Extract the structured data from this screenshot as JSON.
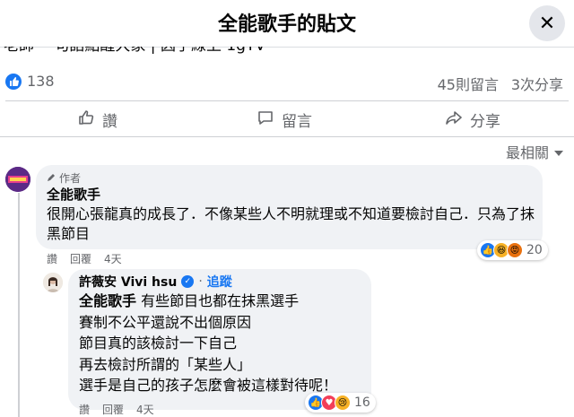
{
  "header": {
    "title": "全能歌手的貼文",
    "close_icon": "close-icon"
  },
  "post": {
    "cut_off_text": "老師 一句話點醒大家 | 因手線上 1gTV"
  },
  "stats": {
    "reaction_count": "138",
    "comment_count": "45則留言",
    "share_count": "3次分享"
  },
  "actions": {
    "like_label": "讚",
    "comment_label": "留言",
    "share_label": "分享"
  },
  "sort": {
    "label": "最相關"
  },
  "comments": [
    {
      "author_tag": "作者",
      "name": "全能歌手",
      "text": "很開心張龍真的成長了．不像某些人不明就理或不知道要檢討自己．只為了抹黑節目",
      "like_label": "讚",
      "reply_label": "回覆",
      "time": "4天",
      "reaction_count": "20"
    }
  ],
  "reply": {
    "name": "許薇安 Vivi hsu",
    "follow_label": "追蹤",
    "mention": "全能歌手",
    "lines": [
      "有些節目也都在抹黑選手",
      "賽制不公平還說不出個原因",
      "節目真的該檢討一下自己",
      "再去檢討所謂的「某些人」",
      "選手是自己的孩子怎麼會被這樣對待呢！"
    ],
    "like_label": "讚",
    "reply_label": "回覆",
    "time": "4天",
    "reaction_count": "16"
  },
  "colors": {
    "accent": "#1877f2",
    "bubble": "#f0f2f5",
    "muted": "#65676b"
  }
}
